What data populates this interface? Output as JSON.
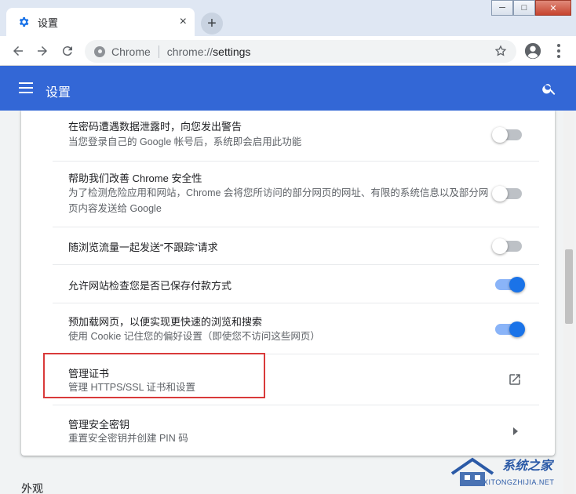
{
  "window": {
    "tab_title": "设置",
    "tab_close": "×",
    "new_tab": "+",
    "controls": {
      "minimize": "─",
      "maximize": "□",
      "close": "✕"
    }
  },
  "omnibox": {
    "site_name": "Chrome",
    "url_scheme": "chrome://",
    "url_path": "settings"
  },
  "header": {
    "title": "设置"
  },
  "rows": [
    {
      "label": "在密码遭遇数据泄露时，向您发出警告",
      "sub": "当您登录自己的 Google 帐号后，系统即会启用此功能",
      "control": "toggle",
      "checked": false
    },
    {
      "label": "帮助我们改善 Chrome 安全性",
      "sub": "为了检测危险应用和网站，Chrome 会将您所访问的部分网页的网址、有限的系统信息以及部分网页内容发送给 Google",
      "control": "toggle",
      "checked": false
    },
    {
      "label": "随浏览流量一起发送“不跟踪”请求",
      "sub": "",
      "control": "toggle",
      "checked": false
    },
    {
      "label": "允许网站检查您是否已保存付款方式",
      "sub": "",
      "control": "toggle",
      "checked": true
    },
    {
      "label": "预加载网页，以便实现更快速的浏览和搜索",
      "sub": "使用 Cookie 记住您的偏好设置（即使您不访问这些网页）",
      "control": "toggle",
      "checked": true
    },
    {
      "label": "管理证书",
      "sub": "管理 HTTPS/SSL 证书和设置",
      "control": "external-link"
    },
    {
      "label": "管理安全密钥",
      "sub": "重置安全密钥并创建 PIN 码",
      "control": "arrow"
    }
  ],
  "next_section_title": "外观",
  "watermark": {
    "cn": "系统之家",
    "en": "XITONGZHIJIA.NET"
  },
  "colors": {
    "header_bg": "#3367d6",
    "toggle_on": "#1a73e8",
    "highlight_border": "#d93a3a"
  }
}
